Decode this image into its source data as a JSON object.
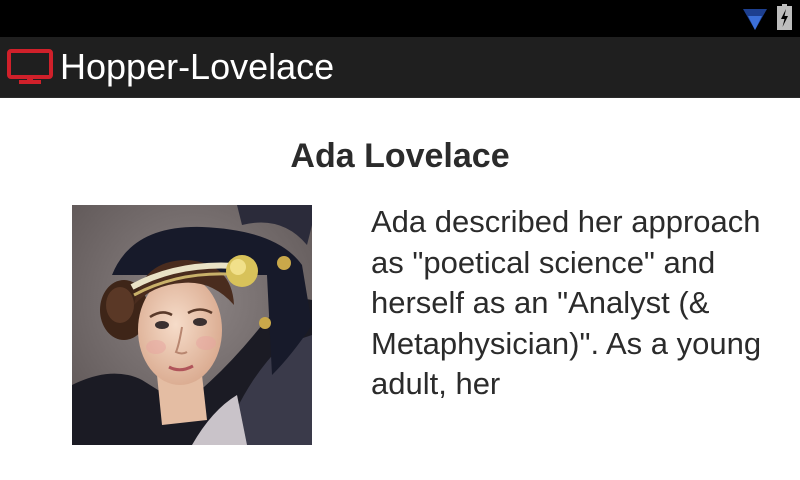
{
  "app": {
    "title": "Hopper-Lovelace"
  },
  "status_bar": {
    "icons": [
      "wifi-icon",
      "battery-charging-icon"
    ]
  },
  "colors": {
    "app_icon": "#d0202a",
    "status_bar": "#000000",
    "action_bar": "#1f1f1f",
    "wifi": "#3b6fd8",
    "text": "#2b2b2b"
  },
  "profile": {
    "name": "Ada Lovelace",
    "bio": "Ada described her approach as \"poetical science\" and herself as an \"Analyst (& Metaphysician)\". As a young adult, her"
  }
}
